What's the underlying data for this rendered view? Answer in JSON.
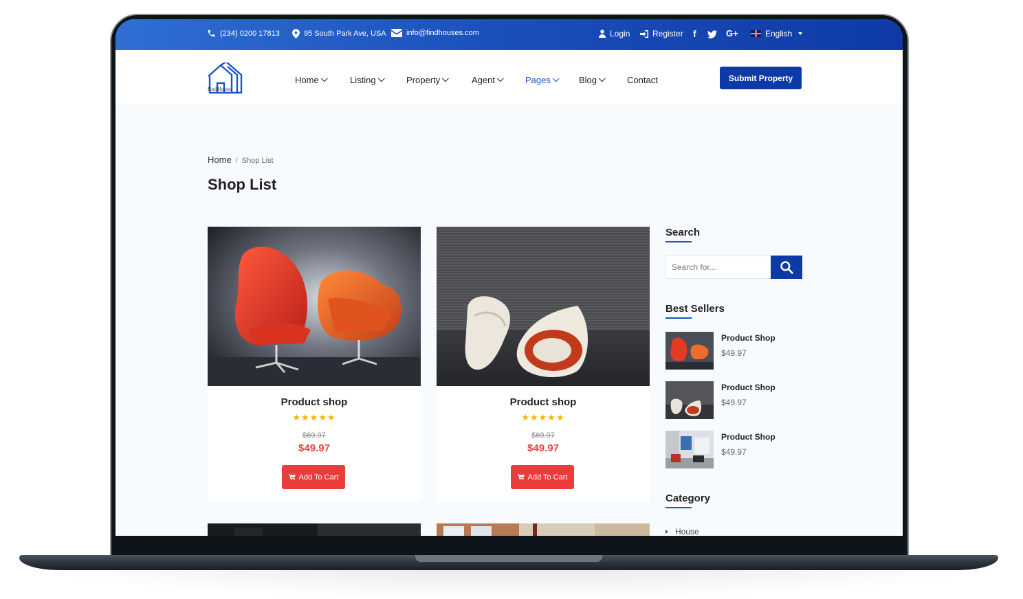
{
  "topbar": {
    "phone": "(234) 0200 17813",
    "address": "95 South Park Ave, USA",
    "email": "info@findhouses.com",
    "login": "Login",
    "register": "Register",
    "language": "English",
    "social": [
      "facebook-icon",
      "twitter-icon",
      "google-plus-icon"
    ]
  },
  "nav": {
    "logo_text": "Find Houses",
    "items": [
      {
        "label": "Home"
      },
      {
        "label": "Listing"
      },
      {
        "label": "Property"
      },
      {
        "label": "Agent"
      },
      {
        "label": "Pages"
      },
      {
        "label": "Blog"
      },
      {
        "label": "Contact"
      }
    ],
    "active": "Pages",
    "submit_label": "Submit Property"
  },
  "breadcrumb": {
    "home": "Home",
    "separator": "/",
    "current": "Shop List"
  },
  "page_title": "Shop List",
  "products": [
    {
      "name": "Product shop",
      "rating": 5,
      "stars": "★★★★★",
      "old_price": "$69.97",
      "price": "$49.97",
      "cart_label": "Add To Cart"
    },
    {
      "name": "Product shop",
      "rating": 5,
      "stars": "★★★★★",
      "old_price": "$69.97",
      "price": "$49.97",
      "cart_label": "Add To Cart"
    }
  ],
  "sidebar": {
    "search_title": "Search",
    "search_placeholder": "Search for...",
    "best_sellers_title": "Best Sellers",
    "best_sellers": [
      {
        "name": "Product Shop",
        "price": "$49.97"
      },
      {
        "name": "Product Shop",
        "price": "$49.97"
      },
      {
        "name": "Product Shop",
        "price": "$49.97"
      }
    ],
    "category_title": "Category",
    "categories": [
      "House"
    ]
  },
  "colors": {
    "primary": "#0d3aa6",
    "accent_blue": "#1a55c4",
    "price_red": "#e84443",
    "cart_red": "#ec3b3b",
    "star": "#f5b400"
  }
}
